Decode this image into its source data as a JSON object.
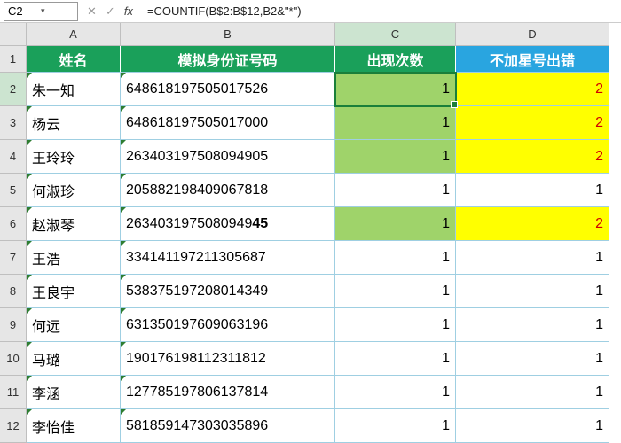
{
  "nameBox": "C2",
  "formula": "=COUNTIF(B$2:B$12,B2&\"*\")",
  "colHeaders": {
    "A": "A",
    "B": "B",
    "C": "C",
    "D": "D"
  },
  "headers": {
    "name": "姓名",
    "id": "模拟身份证号码",
    "count": "出现次数",
    "error": "不加星号出错"
  },
  "fx": "fx",
  "chevron": "▾",
  "cancel": "✕",
  "confirm": "✓",
  "rows": [
    {
      "n": "1"
    },
    {
      "n": "2",
      "name": "朱一知",
      "id": "648618197505017526",
      "count": "1",
      "err": "2",
      "hl": true
    },
    {
      "n": "3",
      "name": "杨云",
      "id": "648618197505017000",
      "count": "1",
      "err": "2",
      "hl": true
    },
    {
      "n": "4",
      "name": "王玲玲",
      "id": "263403197508094905",
      "count": "1",
      "err": "2",
      "hl": true
    },
    {
      "n": "5",
      "name": "何淑珍",
      "id": "205882198409067818",
      "count": "1",
      "err": "1",
      "hl": false
    },
    {
      "n": "6",
      "name": "赵淑琴",
      "idPrefix": "2634031975080949",
      "idSuffix": "45",
      "count": "1",
      "err": "2",
      "hl": true,
      "boldSuffix": true
    },
    {
      "n": "7",
      "name": "王浩",
      "id": "334141197211305687",
      "count": "1",
      "err": "1",
      "hl": false
    },
    {
      "n": "8",
      "name": "王良宇",
      "id": "538375197208014349",
      "count": "1",
      "err": "1",
      "hl": false
    },
    {
      "n": "9",
      "name": "何远",
      "id": "631350197609063196",
      "count": "1",
      "err": "1",
      "hl": false
    },
    {
      "n": "10",
      "name": "马璐",
      "id": "190176198112311812",
      "count": "1",
      "err": "1",
      "hl": false
    },
    {
      "n": "11",
      "name": "李涵",
      "id": "127785197806137814",
      "count": "1",
      "err": "1",
      "hl": false
    },
    {
      "n": "12",
      "name": "李怡佳",
      "id": "581859147303035896",
      "count": "1",
      "err": "1",
      "hl": false
    }
  ]
}
